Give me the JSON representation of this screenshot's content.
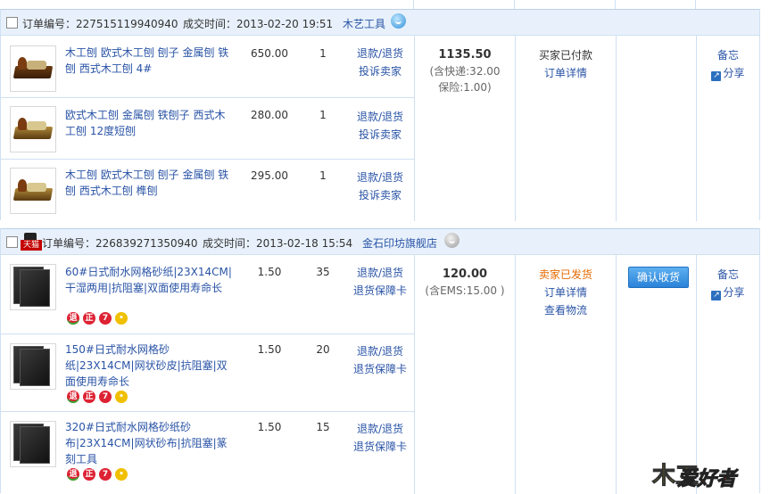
{
  "orders": [
    {
      "order_label": "订单编号：",
      "order_no": "227515119940940",
      "time_label": "成交时间：",
      "time": "2013-02-20 19:51",
      "shop": "木艺工具",
      "items": [
        {
          "title": "木工刨 欧式木工刨 刨子 金属刨 铁刨 西式木工刨 4#",
          "price": "650.00",
          "qty": "1",
          "action1": "退款/退货",
          "action2": "投诉卖家"
        },
        {
          "title": "欧式木工刨 金属刨 铁刨子 西式木工刨 12度短刨",
          "price": "280.00",
          "qty": "1",
          "action1": "退款/退货",
          "action2": "投诉卖家"
        },
        {
          "title": "木工刨 欧式木工刨 刨子 金属刨 铁刨 西式木工刨 榫刨",
          "price": "295.00",
          "qty": "1",
          "action1": "退款/退货",
          "action2": "投诉卖家"
        }
      ],
      "total": "1135.50",
      "total_note1": "(含快递:32.00",
      "total_note2": "保险:1.00)",
      "status": "买家已付款",
      "detail_link": "订单详情",
      "memo": "备忘",
      "share": "分享"
    },
    {
      "tmall_badge": "天猫",
      "order_label": "订单编号：",
      "order_no": "226839271350940",
      "time_label": "成交时间：",
      "time": "2013-02-18 15:54",
      "shop": "金石印坊旗舰店",
      "items": [
        {
          "title": "60#日式耐水网格砂纸|23X14CM|干湿两用|抗阻塞|双面使用寿命长",
          "price": "1.50",
          "qty": "35",
          "action1": "退款/退货",
          "action2": "退货保障卡"
        },
        {
          "title": "150#日式耐水网格砂纸|23X14CM|网状砂皮|抗阻塞|双面使用寿命长",
          "price": "1.50",
          "qty": "20",
          "action1": "退款/退货",
          "action2": "退货保障卡"
        },
        {
          "title": "320#日式耐水网格砂纸砂布|23X14CM|网状砂布|抗阻塞|篆刻工具",
          "price": "1.50",
          "qty": "15",
          "action1": "退款/退货",
          "action2": "退货保障卡"
        }
      ],
      "total": "120.00",
      "total_note1": "(含EMS:15.00 )",
      "status": "卖家已发货",
      "detail_link": "订单详情",
      "logistics_link": "查看物流",
      "confirm_button": "确认收货",
      "memo": "备忘",
      "share": "分享"
    }
  ],
  "watermark": {
    "part1": "木工",
    "part2": "爱好者"
  }
}
